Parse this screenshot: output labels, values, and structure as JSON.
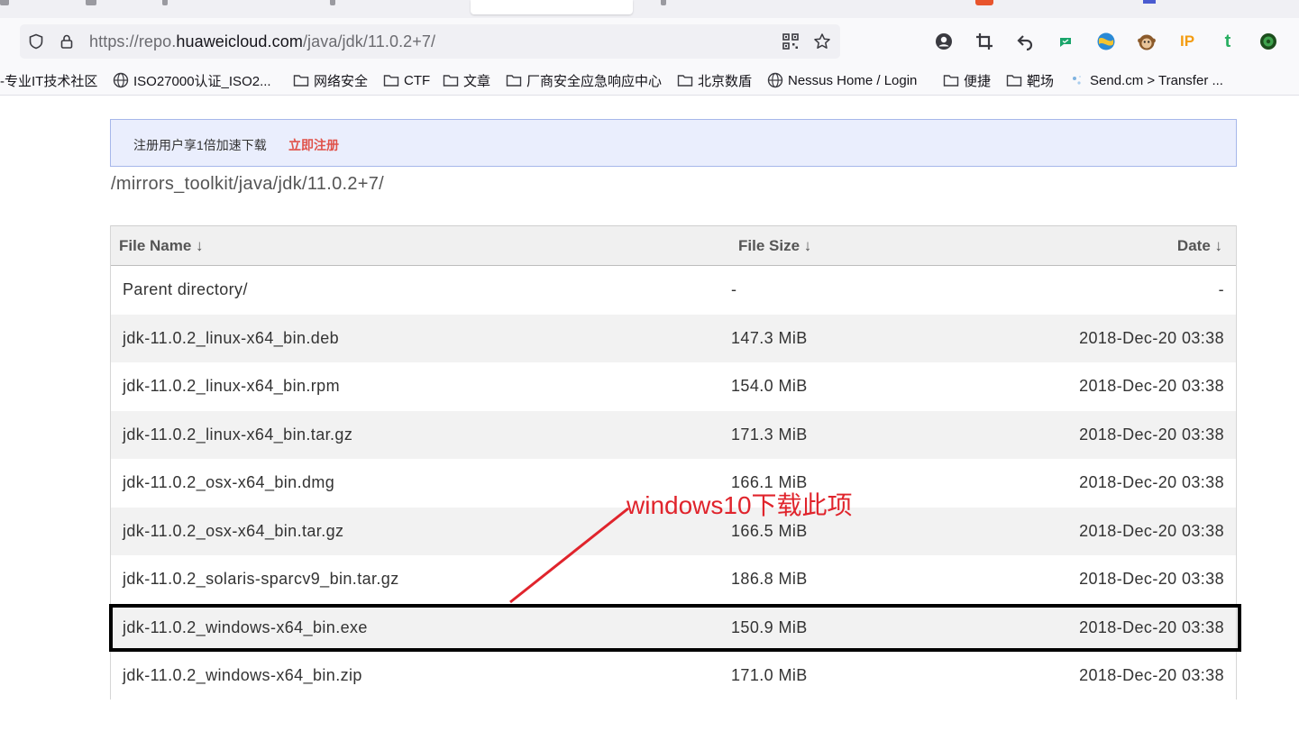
{
  "browser": {
    "url_prefix": "https://repo.",
    "url_host": "huaweicloud.com",
    "url_path": "/java/jdk/11.0.2+7/"
  },
  "bookmarks": [
    {
      "label": "-专业IT技术社区",
      "icon": "none"
    },
    {
      "label": "ISO27000认证_ISO2...",
      "icon": "globe-icon"
    },
    {
      "label": "网络安全",
      "icon": "folder-icon"
    },
    {
      "label": "CTF",
      "icon": "folder-icon"
    },
    {
      "label": "文章",
      "icon": "folder-icon"
    },
    {
      "label": "厂商安全应急响应中心",
      "icon": "folder-icon"
    },
    {
      "label": "北京数盾",
      "icon": "folder-icon"
    },
    {
      "label": "Nessus Home / Login",
      "icon": "globe-icon"
    },
    {
      "label": "便捷",
      "icon": "folder-icon"
    },
    {
      "label": "靶场",
      "icon": "folder-icon"
    },
    {
      "label": "Send.cm > Transfer ...",
      "icon": "sparkle-icon"
    }
  ],
  "notice": {
    "text": "注册用户享1倍加速下载",
    "link": "立即注册"
  },
  "path": "/mirrors_toolkit/java/jdk/11.0.2+7/",
  "table": {
    "headers": {
      "name": "File Name  ↓",
      "size": "File Size  ↓",
      "date": "Date  ↓"
    },
    "rows": [
      {
        "name": "Parent directory/",
        "size": "-",
        "date": "-"
      },
      {
        "name": "jdk-11.0.2_linux-x64_bin.deb",
        "size": "147.3 MiB",
        "date": "2018-Dec-20 03:38"
      },
      {
        "name": "jdk-11.0.2_linux-x64_bin.rpm",
        "size": "154.0 MiB",
        "date": "2018-Dec-20 03:38"
      },
      {
        "name": "jdk-11.0.2_linux-x64_bin.tar.gz",
        "size": "171.3 MiB",
        "date": "2018-Dec-20 03:38"
      },
      {
        "name": "jdk-11.0.2_osx-x64_bin.dmg",
        "size": "166.1 MiB",
        "date": "2018-Dec-20 03:38"
      },
      {
        "name": "jdk-11.0.2_osx-x64_bin.tar.gz",
        "size": "166.5 MiB",
        "date": "2018-Dec-20 03:38"
      },
      {
        "name": "jdk-11.0.2_solaris-sparcv9_bin.tar.gz",
        "size": "186.8 MiB",
        "date": "2018-Dec-20 03:38"
      },
      {
        "name": "jdk-11.0.2_windows-x64_bin.exe",
        "size": "150.9 MiB",
        "date": "2018-Dec-20 03:38"
      },
      {
        "name": "jdk-11.0.2_windows-x64_bin.zip",
        "size": "171.0 MiB",
        "date": "2018-Dec-20 03:38"
      }
    ]
  },
  "annotation": {
    "text": "windows10下载此项",
    "color": "#e0242c"
  },
  "colors": {
    "notice_bg": "#eaeefd",
    "notice_link": "#e0524a",
    "row_alt": "#f2f2f2"
  }
}
